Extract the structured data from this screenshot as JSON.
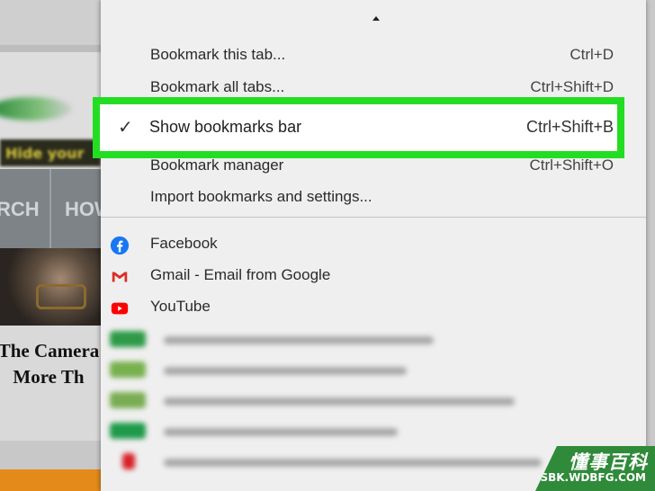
{
  "background_page": {
    "banner_text": "Hide your",
    "nav_items": [
      "RCH",
      "HOW"
    ],
    "headline_lines": [
      "The Camera",
      "More Th"
    ]
  },
  "menu": {
    "items": [
      {
        "label": "Bookmark this tab...",
        "shortcut": "Ctrl+D"
      },
      {
        "label": "Bookmark all tabs...",
        "shortcut": "Ctrl+Shift+D"
      },
      {
        "label": "Show bookmarks bar",
        "shortcut": "Ctrl+Shift+B",
        "checked": true,
        "check_icon": "checkmark-icon"
      },
      {
        "label": "Bookmark manager",
        "shortcut": "Ctrl+Shift+O"
      },
      {
        "label": "Import bookmarks and settings...",
        "shortcut": ""
      }
    ],
    "bookmarks": [
      {
        "label": "Facebook",
        "icon": "facebook-icon",
        "color": "#1877f2"
      },
      {
        "label": "Gmail - Email from Google",
        "icon": "gmail-icon",
        "color": "#d93025"
      },
      {
        "label": "YouTube",
        "icon": "youtube-icon",
        "color": "#ff0000"
      }
    ],
    "blurred_bookmarks": [
      {
        "icon": "blurred-favicon",
        "color": "#2e9a48"
      },
      {
        "icon": "blurred-favicon",
        "color": "#78b04e"
      },
      {
        "icon": "blurred-favicon",
        "color": "#79ad52"
      },
      {
        "icon": "blurred-favicon",
        "color": "#1f9a4a"
      },
      {
        "icon": "netflix-icon",
        "color": "#d81f26"
      }
    ]
  },
  "highlight_color": "#22dd22",
  "watermark": {
    "chinese": "懂事百科",
    "site": "DSBK.WDBFG.COM"
  }
}
